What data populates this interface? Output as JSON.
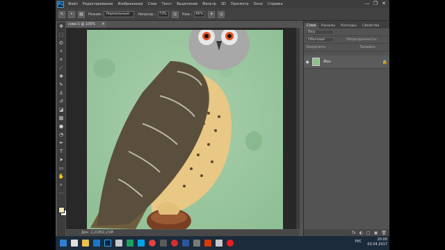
{
  "app": {
    "logo": "Ps",
    "menu": [
      "Файл",
      "Редактирование",
      "Изображение",
      "Слои",
      "Текст",
      "Выделение",
      "Фильтр",
      "3D",
      "Просмотр",
      "Окно",
      "Справка"
    ],
    "window_controls": [
      "—",
      "❐",
      "✕"
    ]
  },
  "options": {
    "mode_label": "Режим:",
    "mode_value": "Нормальный",
    "opacity_label": "Непрозр.:",
    "opacity_value": "73%",
    "flow_label": "Наж.:",
    "flow_value": "66%"
  },
  "document": {
    "tab_label": "сова-1 @ 100% (RGB/8)",
    "close": "×",
    "status": "Док: 2,21M/2,21M"
  },
  "layers_panel": {
    "tabs": [
      "Слои",
      "Каналы",
      "Контуры",
      "Свойства"
    ],
    "active_tab": "Слои",
    "search_placeholder": "Вид",
    "blend_mode": "Обычные",
    "opacity_label": "Непрозрачность:",
    "lock_label": "Закрепить:",
    "fill_label": "Заливка:",
    "layer_name": "Фон",
    "bottom_icons": [
      "fx",
      "◐",
      "▢",
      "▣",
      "🗑"
    ]
  },
  "taskbar": {
    "lang": "РУС",
    "time": "20:00",
    "date": "03.04.2017"
  },
  "colors": {
    "foreground": "#f2e6b3",
    "background": "#fafafa",
    "canvas_bg": "#9fc7a2"
  }
}
